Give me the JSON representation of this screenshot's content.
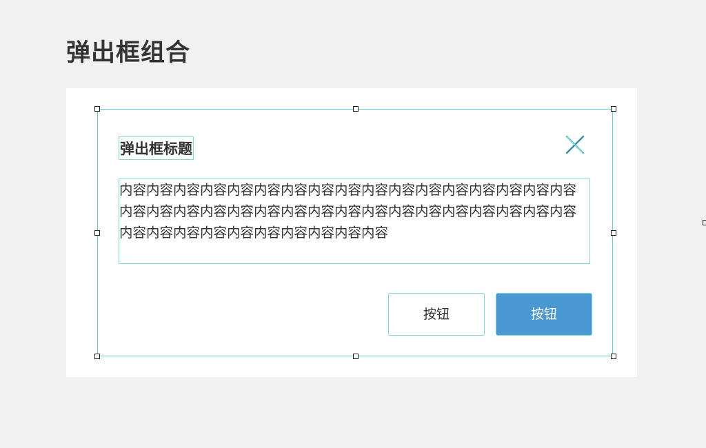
{
  "page": {
    "heading": "弹出框组合"
  },
  "dialog": {
    "title": "弹出框标题",
    "close_icon": "close-icon",
    "body_text": "内容内容内容内容内容内容内容内容内容内容内容内容内容内容内容内容内容内容内容内容内容内容内容内容内容内容内容内容内容内容内容内容内容内容内容内容内容内容内容内容内容内容内容内容",
    "secondary_button_label": "按钮",
    "primary_button_label": "按钮"
  },
  "colors": {
    "background": "#f1f1f1",
    "canvas": "#ffffff",
    "selection_outline": "#5dd5d5",
    "primary_button": "#4a98d1",
    "text": "#333333",
    "close_icon_stroke": "#5bbfbf"
  }
}
